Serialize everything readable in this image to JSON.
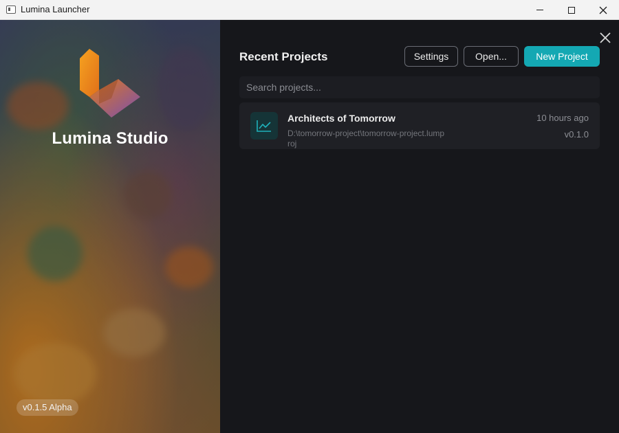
{
  "window": {
    "title": "Lumina Launcher"
  },
  "hero": {
    "app_name": "Lumina Studio",
    "version_badge": "v0.1.5 Alpha",
    "logo_color": "#f0921e"
  },
  "panel": {
    "title": "Recent Projects",
    "buttons": {
      "settings": "Settings",
      "open": "Open...",
      "new_project": "New Project"
    },
    "search": {
      "placeholder": "Search projects..."
    },
    "projects": [
      {
        "name": "Architects of Tomorrow",
        "path": "D:\\tomorrow-project\\tomorrow-project.lumproj",
        "modified": "10 hours ago",
        "version": "v0.1.0",
        "icon": "chart-line-icon"
      }
    ]
  },
  "colors": {
    "accent": "#14a8b3",
    "panel_bg": "#16171b",
    "card_bg": "#1f2025"
  }
}
